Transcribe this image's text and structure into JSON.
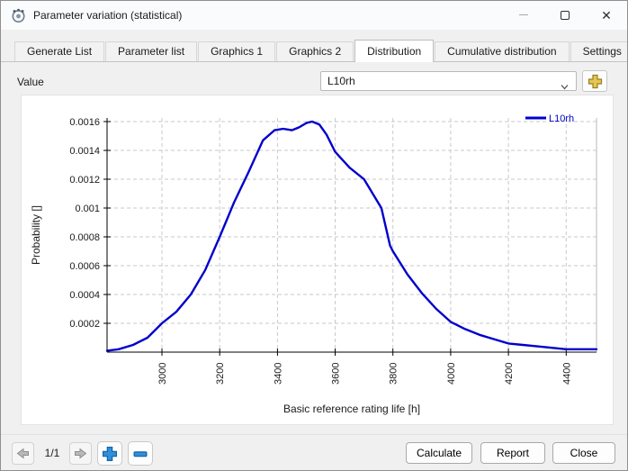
{
  "window": {
    "title": "Parameter variation (statistical)"
  },
  "tabs": [
    {
      "label": "Generate List"
    },
    {
      "label": "Parameter list"
    },
    {
      "label": "Graphics 1"
    },
    {
      "label": "Graphics 2"
    },
    {
      "label": "Distribution"
    },
    {
      "label": "Cumulative distribution"
    },
    {
      "label": "Settings"
    }
  ],
  "active_tab": "Distribution",
  "value_row": {
    "label": "Value",
    "selected": "L10rh"
  },
  "chart_data": {
    "type": "line",
    "xlabel": "Basic reference rating life [h]",
    "ylabel": "Probability []",
    "xlim": [
      2810,
      4505
    ],
    "ylim": [
      0,
      0.001625
    ],
    "xticks": [
      3000,
      3200,
      3400,
      3600,
      3800,
      4000,
      4200,
      4400
    ],
    "yticks": [
      0.0002,
      0.0004,
      0.0006,
      0.0008,
      0.001,
      0.0012,
      0.0014,
      0.0016
    ],
    "grid": true,
    "legend": {
      "position": "top-right",
      "entries": [
        {
          "label": "L10rh",
          "color": "#0000cc"
        }
      ]
    },
    "series": [
      {
        "name": "L10rh",
        "color": "#0000cc",
        "x": [
          2810,
          2850,
          2900,
          2950,
          3000,
          3050,
          3100,
          3150,
          3200,
          3250,
          3300,
          3350,
          3390,
          3420,
          3450,
          3475,
          3500,
          3520,
          3545,
          3570,
          3600,
          3650,
          3700,
          3760,
          3790,
          3800,
          3850,
          3900,
          3950,
          4000,
          4050,
          4100,
          4150,
          4200,
          4250,
          4300,
          4350,
          4400,
          4450,
          4505
        ],
        "y": [
          1e-05,
          2e-05,
          5e-05,
          0.0001,
          0.0002,
          0.00028,
          0.0004,
          0.00057,
          0.0008,
          0.00104,
          0.00125,
          0.00147,
          0.00154,
          0.00155,
          0.00154,
          0.00156,
          0.00159,
          0.0016,
          0.00158,
          0.00151,
          0.00139,
          0.00128,
          0.0012,
          0.001,
          0.00074,
          0.0007,
          0.00054,
          0.00041,
          0.0003,
          0.00021,
          0.00016,
          0.00012,
          9e-05,
          6e-05,
          5e-05,
          4e-05,
          3e-05,
          2e-05,
          2e-05,
          2e-05
        ]
      }
    ]
  },
  "footer": {
    "page_indicator": "1/1",
    "calculate_label": "Calculate",
    "report_label": "Report",
    "close_label": "Close"
  }
}
